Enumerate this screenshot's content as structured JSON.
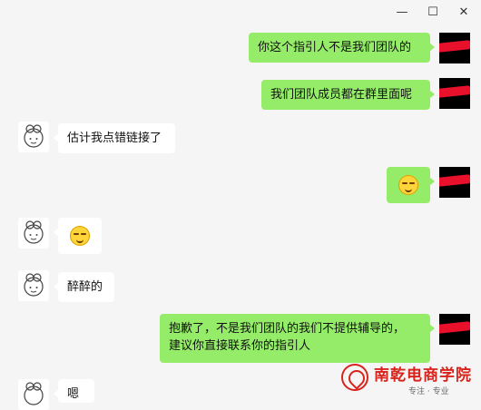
{
  "window": {
    "minimize_glyph": "—",
    "maximize_glyph": "☐",
    "close_glyph": "✕"
  },
  "messages": [
    {
      "side": "out",
      "text": "你这个指引人不是我们团队的"
    },
    {
      "side": "out",
      "text": "我们团队成员都在群里面呢"
    },
    {
      "side": "in",
      "text": "估计我点错链接了"
    },
    {
      "side": "out",
      "emoji": "embarrassed-emoji"
    },
    {
      "side": "in",
      "emoji": "embarrassed-emoji"
    },
    {
      "side": "in",
      "text": "醉醉的"
    },
    {
      "side": "out",
      "lines": [
        "抱歉了，不是我们团队的我们不提供辅导的，",
        "建议你直接联系你的指引人"
      ]
    },
    {
      "side": "in",
      "text": "嗯"
    }
  ],
  "watermark": {
    "title": "南乾电商学院",
    "subtitle": "专注 · 专业"
  },
  "colors": {
    "outgoing_bubble": "#95ec69",
    "incoming_bubble": "#ffffff",
    "background": "#f5f5f5",
    "redaction": "#e8102a",
    "watermark": "#d8241c"
  }
}
